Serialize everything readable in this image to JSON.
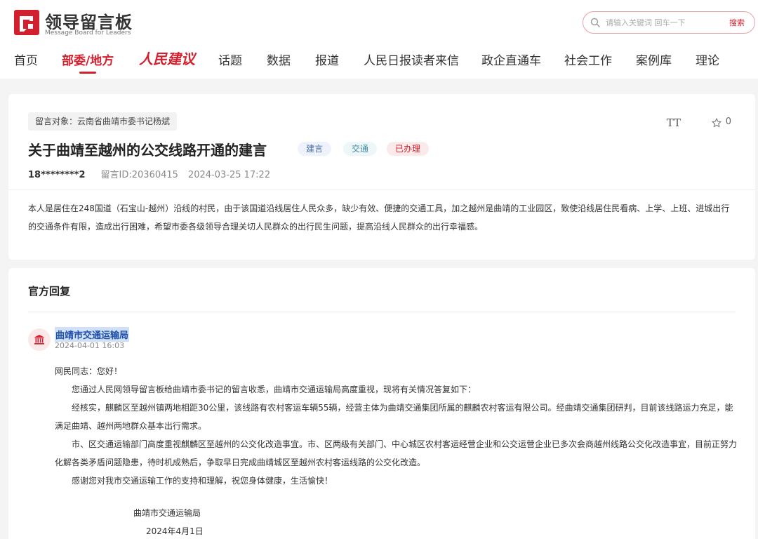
{
  "header": {
    "logo_title": "领导留言板",
    "logo_subtitle": "Message Board for Leaders",
    "search_placeholder": "请输入关键词 回车一下",
    "search_button": "搜索"
  },
  "nav": {
    "items": [
      "首页",
      "部委/地方",
      "人民建议",
      "话题",
      "数据",
      "报道",
      "人民日报读者来信",
      "政企直通车",
      "社会工作",
      "案例库",
      "理论"
    ],
    "active_index": 1
  },
  "message": {
    "target": "留言对象：云南省曲靖市委书记杨斌",
    "title": "关于曲靖至越州的公交线路开通的建言",
    "tags": [
      "建言",
      "交通",
      "已办理"
    ],
    "user": "18********2",
    "message_id": "留言ID:20360415",
    "datetime": "2024-03-25 17:22",
    "font_tool": "TT",
    "favorite_count": "0",
    "content": "本人是居住在248国道（石宝山-越州）沿线的村民，由于该国道沿线居住人民众多，缺少有效、便捷的交通工具，加之越州是曲靖的工业园区，致使沿线居住民看病、上学、上班、进城出行的交通条件有限，造成出行困难，希望市委各级领导合理关切人民群众的出行民生问题，提高沿线人民群众的出行幸福感。"
  },
  "reply": {
    "heading": "官方回复",
    "department": "曲靖市交通运输局",
    "datetime": "2024-04-01 16:03",
    "greeting": "网民同志：您好！",
    "paragraphs": [
      "您通过人民网领导留言板给曲靖市委书记的留言收悉，曲靖市交通运输局高度重视，现将有关情况答复如下：",
      "经核实，麒麟区至越州镇两地相距30公里，该线路有农村客运车辆55辆，经营主体为曲靖交通集团所属的麒麟农村客运有限公司。经曲靖交通集团研判，目前该线路运力充足，能满足曲靖、越州两地群众基本出行需求。",
      "市、区交通运输部门高度重视麒麟区至越州的公交化改造事宜。市、区两级有关部门、中心城区农村客运经营企业和公交运营企业已多次会商越州线路公交化改造事宜，目前正努力化解各类矛盾问题隐患，待时机成熟后，争取早日完成曲靖城区至越州农村客运线路的公交化改造。",
      "感谢您对我市交通运输工作的支持和理解，祝您身体健康，生活愉快！"
    ],
    "signature_org": "曲靖市交通运输局",
    "signature_date": "2024年4月1日"
  },
  "colors": {
    "brand_red": "#d3202f",
    "link_blue": "#1f4fa8"
  }
}
